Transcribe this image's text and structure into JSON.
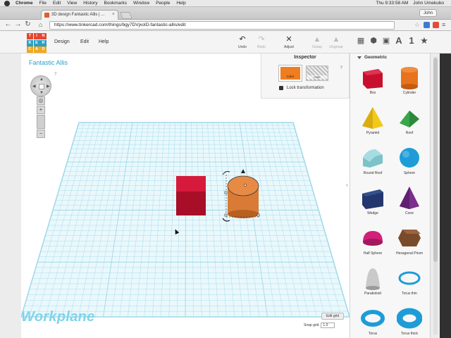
{
  "menubar": {
    "items": [
      "Chrome",
      "File",
      "Edit",
      "View",
      "History",
      "Bookmarks",
      "Window",
      "People",
      "Help"
    ],
    "clock": "Thu 9:33:58 AM",
    "user": "John Umekubo"
  },
  "browser": {
    "tab_title": "3D design Fantastic Allis | ...",
    "profile": "John",
    "url": "https://www.tinkercad.com/things/bgy7DVjxoID-fantastic-allis/edit"
  },
  "app": {
    "logo_letters": [
      "TIN",
      "KER",
      "CAD"
    ],
    "menu": {
      "design": "Design",
      "edit": "Edit",
      "help": "Help"
    },
    "tools": {
      "undo": "Undo",
      "redo": "Redo",
      "adjust": "Adjust",
      "group": "Group",
      "ungroup": "Ungroup"
    },
    "view_letter_a": "A",
    "view_digit": "1",
    "design_title": "Fantastic Allis"
  },
  "inspector": {
    "title": "Inspector",
    "color_label": "Color",
    "hole_label": "Hole",
    "help": "?",
    "lock_label": "Lock transformation",
    "selected_color": "#ef7d21"
  },
  "workplane": {
    "label": "Workplane",
    "edit_grid": "Edit grid",
    "snap_label": "Snap grid",
    "snap_value": "1.0"
  },
  "panel": {
    "section": "Geometric",
    "shapes": [
      {
        "name": "Box",
        "color": "#c8102e"
      },
      {
        "name": "Cylinder",
        "color": "#e8731c"
      },
      {
        "name": "Pyramid",
        "color": "#f2c81b"
      },
      {
        "name": "Roof",
        "color": "#3aa64b"
      },
      {
        "name": "Round Roof",
        "color": "#7cc2c9"
      },
      {
        "name": "Sphere",
        "color": "#1e9cd7"
      },
      {
        "name": "Wedge",
        "color": "#23366e"
      },
      {
        "name": "Cone",
        "color": "#7b2e8c"
      },
      {
        "name": "Half Sphere",
        "color": "#d21f7a"
      },
      {
        "name": "Hexagonal Prism",
        "color": "#7a4b2b"
      },
      {
        "name": "Paraboloid",
        "color": "#c9c9c9"
      },
      {
        "name": "Torus thin",
        "color": "#1e9cd7"
      },
      {
        "name": "Torus",
        "color": "#1e9cd7"
      },
      {
        "name": "Torus thick",
        "color": "#1e9cd7"
      }
    ]
  },
  "scene": {
    "box_color": "#c8102e",
    "cylinder_color": "#d97a36",
    "grid_color": "#9fd8e9"
  }
}
